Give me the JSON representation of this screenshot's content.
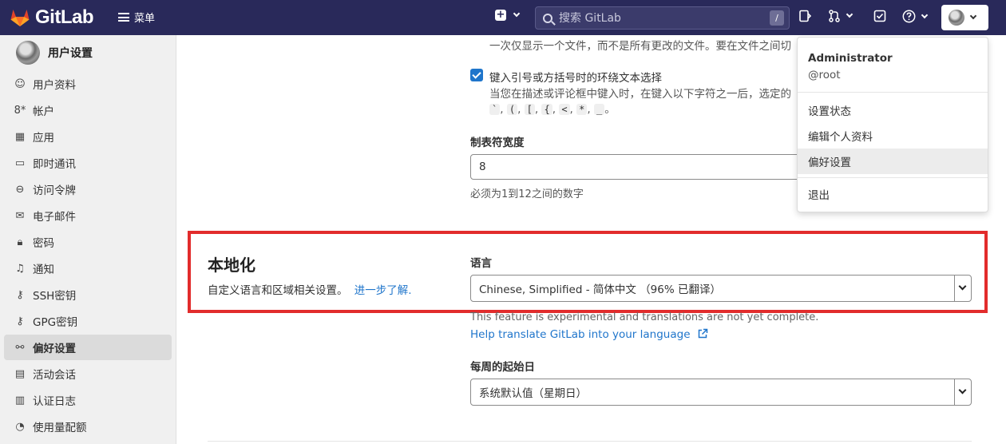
{
  "topbar": {
    "brand": "GitLab",
    "menu_label": "菜单",
    "search_placeholder": "搜索 GitLab",
    "search_shortcut": "/"
  },
  "sidebar": {
    "title": "用户设置",
    "items": [
      {
        "label": "用户资料",
        "icon": "profile-icon"
      },
      {
        "label": "帐户",
        "icon": "account-icon"
      },
      {
        "label": "应用",
        "icon": "applications-icon"
      },
      {
        "label": "即时通讯",
        "icon": "chat-icon"
      },
      {
        "label": "访问令牌",
        "icon": "token-icon"
      },
      {
        "label": "电子邮件",
        "icon": "mail-icon"
      },
      {
        "label": "密码",
        "icon": "lock-icon"
      },
      {
        "label": "通知",
        "icon": "bell-icon"
      },
      {
        "label": "SSH密钥",
        "icon": "key-icon"
      },
      {
        "label": "GPG密钥",
        "icon": "key-icon"
      },
      {
        "label": "偏好设置",
        "icon": "preferences-icon",
        "active": true
      },
      {
        "label": "活动会话",
        "icon": "monitor-icon"
      },
      {
        "label": "认证日志",
        "icon": "log-icon"
      },
      {
        "label": "使用量配额",
        "icon": "quota-icon"
      }
    ]
  },
  "content": {
    "one_file_hint": "一次仅显示一个文件，而不是所有更改的文件。要在文件之间切",
    "surround_label": "键入引号或方括号时的环绕文本选择",
    "surround_hint": "当您在描述或评论框中键入时，在键入以下字符之一后，选定的",
    "surround_chars": [
      "`",
      "(",
      "[",
      "{",
      "<",
      "*",
      "_"
    ],
    "tab_width_label": "制表符宽度",
    "tab_width_value": "8",
    "tab_width_hint": "必须为1到12之间的数字",
    "localization_title": "本地化",
    "localization_desc": "自定义语言和区域相关设置。",
    "learn_more": "进一步了解.",
    "language_label": "语言",
    "language_value": "Chinese, Simplified - 简体中文 （96% 已翻译）",
    "experimental_note": "This feature is experimental and translations are not yet complete.",
    "help_translate": "Help translate GitLab into your language",
    "first_day_label": "每周的起始日",
    "first_day_value": "系统默认值（星期日）"
  },
  "user_menu": {
    "name": "Administrator",
    "handle": "@root",
    "items": [
      "设置状态",
      "编辑个人资料",
      "偏好设置",
      "退出"
    ]
  }
}
